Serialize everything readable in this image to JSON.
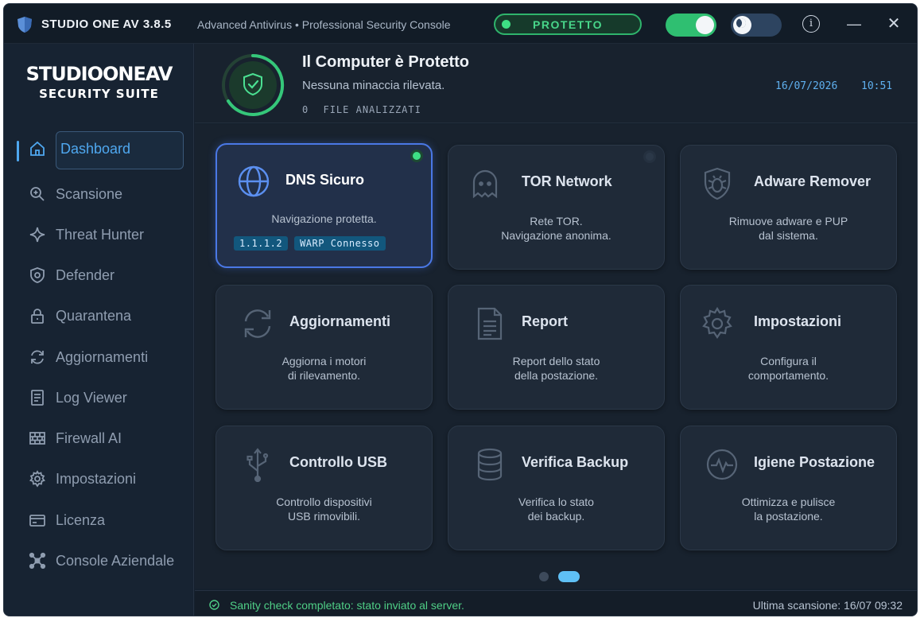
{
  "titlebar": {
    "app_name": "STUDIO ONE AV  3.8.5",
    "subtitle": "Advanced Antivirus  •  Professional Security Console",
    "status": "PROTETTO",
    "info_icon": "i",
    "minimize_icon": "—",
    "close_icon": "✕"
  },
  "brand": {
    "main": "STUDIOONEAV",
    "sub": "SECURITY SUITE"
  },
  "sidebar": {
    "items": [
      {
        "label": "Dashboard",
        "icon": "home-icon",
        "active": true
      },
      {
        "label": "Scansione",
        "icon": "search-icon"
      },
      {
        "label": "Threat Hunter",
        "icon": "sparkle-icon"
      },
      {
        "label": "Defender",
        "icon": "shield-icon"
      },
      {
        "label": "Quarantena",
        "icon": "lock-icon"
      },
      {
        "label": "Aggiornamenti",
        "icon": "refresh-icon"
      },
      {
        "label": "Log Viewer",
        "icon": "document-icon"
      },
      {
        "label": "Firewall AI",
        "icon": "firewall-icon"
      },
      {
        "label": "Impostazioni",
        "icon": "gear-icon"
      },
      {
        "label": "Licenza",
        "icon": "card-icon"
      },
      {
        "label": "Console Aziendale",
        "icon": "network-icon"
      }
    ]
  },
  "header": {
    "title": "Il Computer è Protetto",
    "subtitle": "Nessuna minaccia rilevata.",
    "files_count": "0",
    "files_label": "FILE ANALIZZATI",
    "date": "16/07/2026",
    "time": "10:51"
  },
  "cards": [
    {
      "title": "DNS Sicuro",
      "desc": "Navigazione protetta.",
      "icon": "globe-icon",
      "badges": [
        "1.1.1.2",
        "WARP Connesso"
      ]
    },
    {
      "title": "TOR Network",
      "desc": "Rete TOR.\nNavigazione anonima.",
      "icon": "ghost-icon"
    },
    {
      "title": "Adware Remover",
      "desc": "Rimuove adware e PUP\ndal sistema.",
      "icon": "bug-shield-icon"
    },
    {
      "title": "Aggiornamenti",
      "desc": "Aggiorna i motori\ndi rilevamento.",
      "icon": "refresh-icon"
    },
    {
      "title": "Report",
      "desc": "Report dello stato\ndella postazione.",
      "icon": "report-icon"
    },
    {
      "title": "Impostazioni",
      "desc": "Configura il\ncomportamento.",
      "icon": "gear-icon"
    },
    {
      "title": "Controllo USB",
      "desc": "Controllo dispositivi\nUSB rimovibili.",
      "icon": "usb-icon"
    },
    {
      "title": "Verifica Backup",
      "desc": "Verifica lo stato\ndei backup.",
      "icon": "database-icon"
    },
    {
      "title": "Igiene Postazione",
      "desc": "Ottimizza e pulisce\nla postazione.",
      "icon": "pulse-icon"
    }
  ],
  "pager": {
    "current": 2,
    "total": 2
  },
  "statusbar": {
    "message": "Sanity check completato: stato inviato al server.",
    "last_scan": "Ultima scansione: 16/07 09:32"
  },
  "colors": {
    "accent": "#4fa8f0",
    "ok": "#3ee084",
    "active_border": "#4a78e6"
  }
}
